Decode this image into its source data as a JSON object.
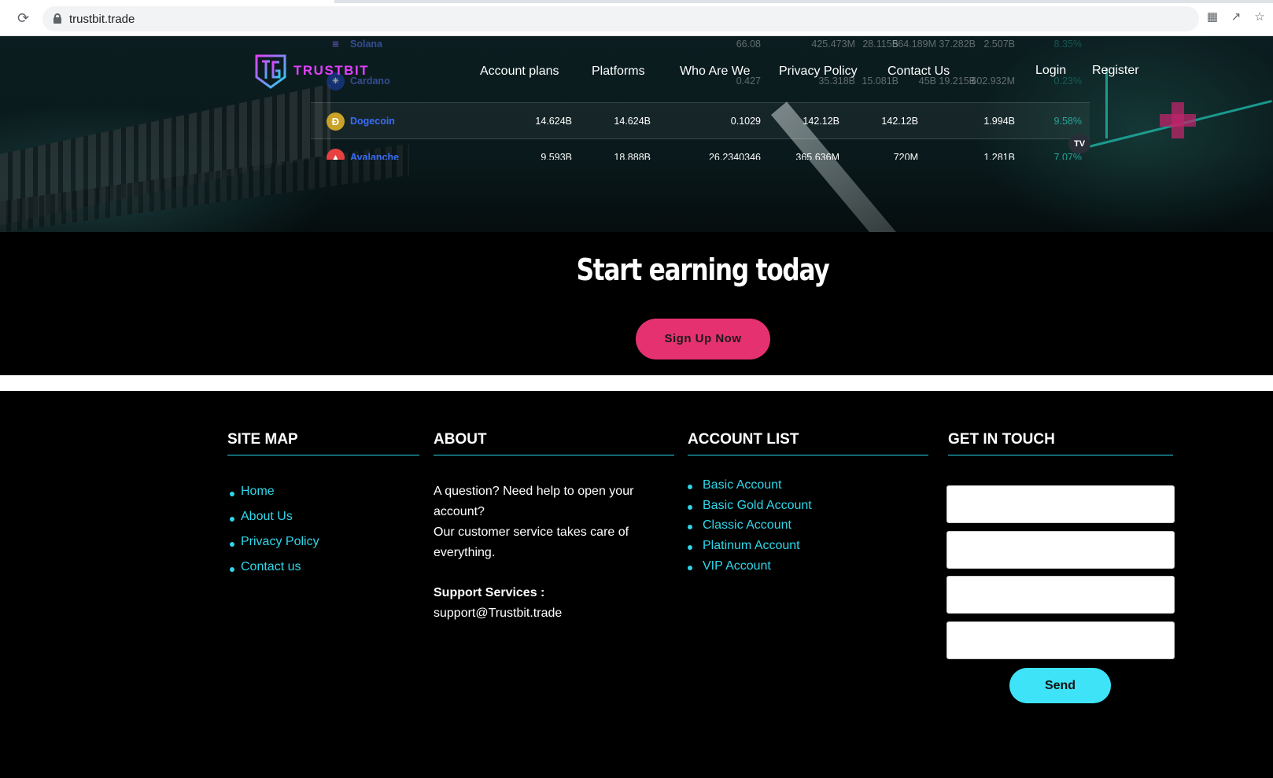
{
  "browser": {
    "url": "trustbit.trade",
    "icons": [
      "back-arrow-icon",
      "reload-icon",
      "lock-icon",
      "extensions-icon",
      "share-icon",
      "bookmark-star-icon"
    ]
  },
  "crypto_table": {
    "rows": [
      {
        "name": "Solana",
        "icon": "solana-icon",
        "color": "#6e5bd6",
        "values": [
          "28.115B",
          "37.282B",
          "66.08",
          "425.473M",
          "564.189M",
          "2.507B",
          "8.35%"
        ]
      },
      {
        "name": "Cardano",
        "icon": "cardano-icon",
        "color": "#1b3fa6",
        "values": [
          "15.081B",
          "19.215B",
          "0.427",
          "35.318B",
          "45B",
          "602.932M",
          "0.23%"
        ]
      },
      {
        "name": "Dogecoin",
        "icon": "dogecoin-icon",
        "color": "#c9a227",
        "values": [
          "14.624B",
          "14.624B",
          "0.1029",
          "142.12B",
          "142.12B",
          "1.994B",
          "9.58%"
        ]
      },
      {
        "name": "Avalanche",
        "icon": "avalanche-icon",
        "color": "#e84142",
        "values": [
          "9.593B",
          "18.888B",
          "26.2340346",
          "365.636M",
          "720M",
          "1.281B",
          "7.07%"
        ]
      }
    ],
    "badge": "TV"
  },
  "header": {
    "logo_text": "TRUSTBIT",
    "nav": [
      "Account plans",
      "Platforms",
      "Who Are We",
      "Privacy Policy",
      "Contact Us"
    ],
    "login": "Login",
    "register": "Register"
  },
  "cta": {
    "title": "Start earning today",
    "button": "Sign Up Now"
  },
  "footer": {
    "sitemap_title": "SITE MAP",
    "sitemap_links": [
      "Home",
      "About Us",
      "Privacy Policy",
      "Contact us"
    ],
    "about_title": "ABOUT",
    "about_line1": "A question? Need help to open your account?",
    "about_line2": "Our customer service takes care of everything.",
    "support_label": "Support Services :",
    "support_email": "support@Trustbit.trade",
    "accounts_title": "ACCOUNT LIST",
    "accounts": [
      "Basic Account",
      "Basic Gold Account",
      "Classic Account",
      "Platinum Account",
      "VIP Account"
    ],
    "contact_title": "GET IN TOUCH",
    "send_label": "Send"
  },
  "colors": {
    "accent_pink": "#e5316f",
    "accent_cyan": "#3ee3f7",
    "link_cyan": "#2fd7ea",
    "coin_link_blue": "#3b6cf5",
    "positive_green": "#26a69a"
  }
}
